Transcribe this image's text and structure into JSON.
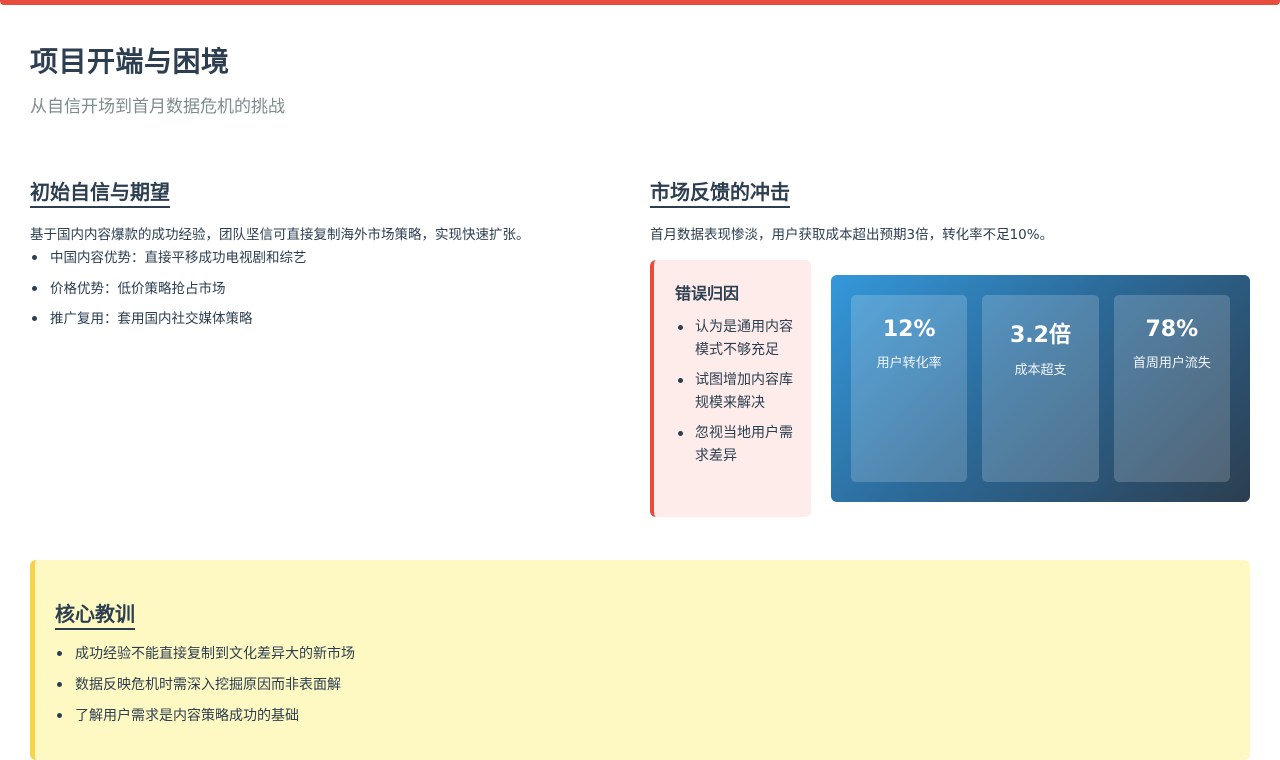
{
  "header": {
    "title": "项目开端与困境",
    "subtitle": "从自信开场到首月数据危机的挑战"
  },
  "left": {
    "heading": "初始自信与期望",
    "intro": "基于国内内容爆款的成功经验，团队坚信可直接复制海外市场策略，实现快速扩张。",
    "items": [
      "中国内容优势：直接平移成功电视剧和综艺",
      "价格优势：低价策略抢占市场",
      "推广复用：套用国内社交媒体策略"
    ]
  },
  "right": {
    "heading": "市场反馈的冲击",
    "intro": "首月数据表现惨淡，用户获取成本超出预期3倍，转化率不足10%。",
    "error_card": {
      "title": "错误归因",
      "items": [
        "认为是通用内容模式不够充足",
        "试图增加内容库规模来解决",
        "忽视当地用户需求差异"
      ]
    },
    "stats": [
      {
        "value": "12%",
        "label": "用户转化率"
      },
      {
        "value": "3.2倍",
        "label": "成本超支"
      },
      {
        "value": "78%",
        "label": "首周用户流失"
      }
    ]
  },
  "lessons": {
    "heading": "核心教训",
    "items": [
      "成功经验不能直接复制到文化差异大的新市场",
      "数据反映危机时需深入挖掘原因而非表面解",
      "了解用户需求是内容策略成功的基础"
    ]
  },
  "colors": {
    "accent": "#e74c3c",
    "text": "#2c3e50",
    "warning_bg": "#fef9c3",
    "warning_border": "#f8d34a"
  }
}
